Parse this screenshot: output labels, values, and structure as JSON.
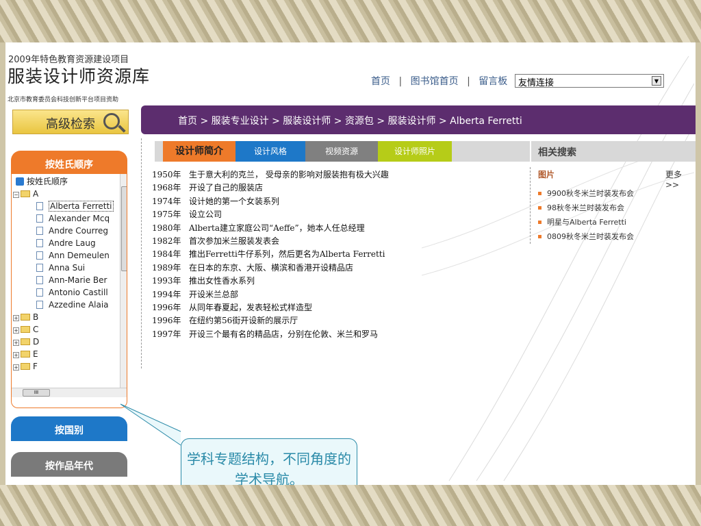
{
  "header": {
    "logo_top": "2009年特色教育资源建设项目",
    "logo_main": "服装设计师资源库",
    "logo_sub": "北京市教育委员会科技创新平台项目资助"
  },
  "topnav": {
    "home": "首页",
    "library_home": "图书馆首页",
    "guestbook": "留言板",
    "separator": "|",
    "links_select": "友情连接"
  },
  "search": {
    "label": "高级检索"
  },
  "breadcrumb": {
    "text": "首页 > 服装专业设计 > 服装设计师 > 资源包 > 服装设计师 > Alberta Ferretti"
  },
  "sidebar": {
    "by_name": "按姓氏顺序",
    "by_country": "按国别",
    "by_year": "按作品年代",
    "tree": {
      "root": "按姓氏顺序",
      "group_a": "A",
      "items_a": [
        "Alberta Ferretti",
        "Alexander Mcq",
        "Andre Courreg",
        "Andre Laug",
        "Ann Demeulen",
        "Anna Sui",
        "Ann-Marie Ber",
        "Antonio Castill",
        "Azzedine Alaia"
      ],
      "groups": [
        "B",
        "C",
        "D",
        "E",
        "F"
      ],
      "scroll_mark": "III"
    }
  },
  "content_tabs": {
    "intro": "设计师简介",
    "style": "设计风格",
    "video": "视频资源",
    "photos": "设计师照片"
  },
  "timeline": [
    {
      "year": "1950年",
      "text": "生于意大利的克兰， 受母亲的影响对服装抱有极大兴趣"
    },
    {
      "year": "1968年",
      "text": "开设了自己的服装店"
    },
    {
      "year": "1974年",
      "text": "设计她的第一个女装系列"
    },
    {
      "year": "1975年",
      "text": "设立公司"
    },
    {
      "year": "1980年",
      "text": "Alberta建立家庭公司“Aeffe”，她本人任总经理"
    },
    {
      "year": "1982年",
      "text": "首次参加米兰服装发表会"
    },
    {
      "year": "1984年",
      "text": "推出Ferretti牛仔系列，然后更名为Alberta  Ferretti"
    },
    {
      "year": "1989年",
      "text": "在日本的东京、大阪、横滨和香港开设精品店"
    },
    {
      "year": "1993年",
      "text": "推出女性香水系列"
    },
    {
      "year": "1994年",
      "text": "开设米兰总部"
    },
    {
      "year": "1996年",
      "text": "从同年春夏起，发表轻松式样造型"
    },
    {
      "year": "1996年",
      "text": "在纽约第56街开设新的展示厅"
    },
    {
      "year": "1997年",
      "text": "开设三个最有名的精品店，分别在伦敦、米兰和罗马"
    }
  ],
  "related": {
    "title": "相关搜索",
    "images_label": "图片",
    "more": "更多>>",
    "items": [
      "9900秋冬米兰时装发布会",
      "98秋冬米兰时装发布会",
      "明星与Alberta Ferretti",
      "0809秋冬米兰时装发布会"
    ]
  },
  "callout": {
    "text": "学科专题结构，不同角度的学术导航。"
  },
  "colors": {
    "orange": "#ee7a2a",
    "blue": "#1e78c8",
    "purple": "#5c2d6e",
    "green": "#b6cc18",
    "gray": "#808080"
  }
}
